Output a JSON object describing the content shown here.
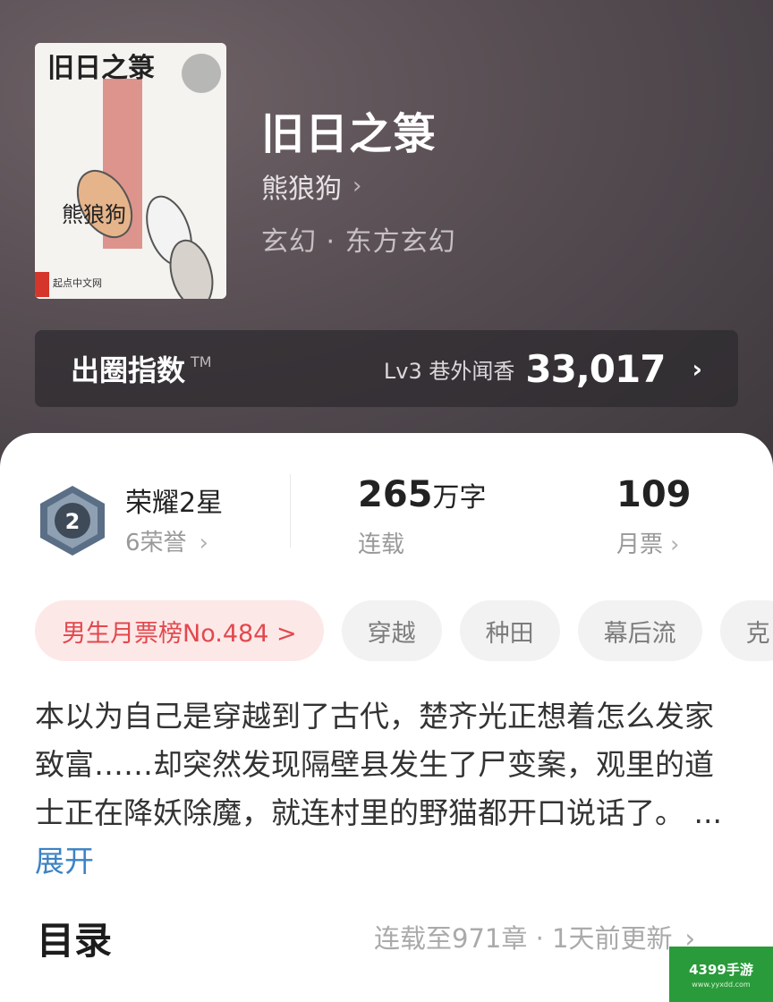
{
  "book": {
    "title": "旧日之箓",
    "author": "熊狼狗",
    "genre": "玄幻 · 东方玄幻",
    "cover": {
      "title_text": "旧日之箓",
      "author_text": "熊狼狗",
      "publisher_text": "起点中文网"
    }
  },
  "influence": {
    "label": "出圈指数",
    "tm": "TM",
    "level": "Lv3 巷外闻香",
    "value": "33,017"
  },
  "stats": {
    "honor_title": "荣耀2星",
    "honor_sub": "6荣誉",
    "honor_badge_number": "2",
    "words_number": "265",
    "words_unit": "万字",
    "words_label": "连载",
    "tickets_number": "109",
    "tickets_label": "月票"
  },
  "tags": [
    "男生月票榜No.484 >",
    "穿越",
    "种田",
    "幕后流",
    "克"
  ],
  "synopsis": {
    "text": "本以为自己是穿越到了古代，楚齐光正想着怎么发家致富……却突然发现隔壁县发生了尸变案，观里的道士正在降妖除魔，就连村里的野猫都开口说话了。",
    "ellipsis": "...",
    "expand_label": "展开"
  },
  "toc": {
    "title": "目录",
    "info": "连载至971章 · 1天前更新"
  },
  "watermark": {
    "main": "4399手游",
    "sub": "www.yyxdd.com"
  },
  "icons": {
    "chevron": "chevron-right-icon",
    "badge": "honor-badge-icon"
  },
  "colors": {
    "accent_red": "#e2484d",
    "link_blue": "#3b82c4",
    "watermark_green": "#2a9b3a"
  }
}
